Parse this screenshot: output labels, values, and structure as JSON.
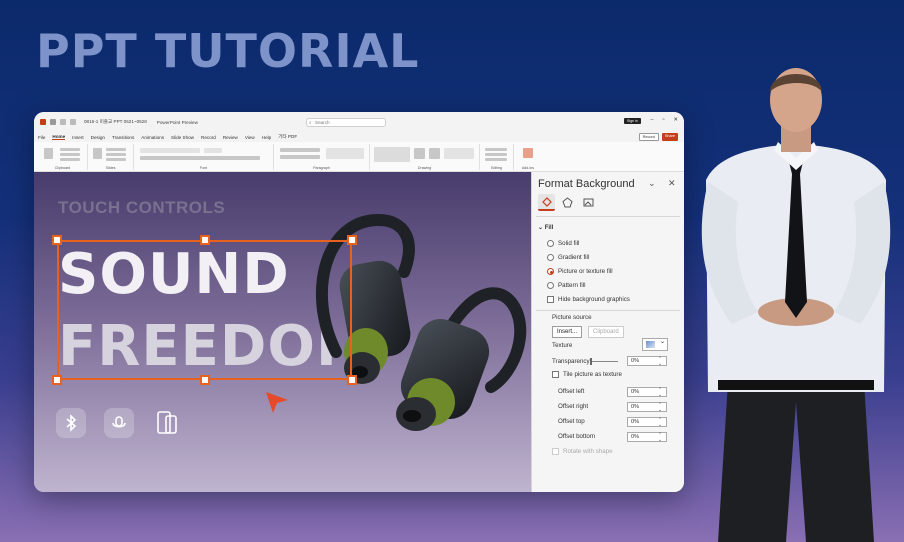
{
  "headline": "PPT TUTORIAL",
  "app": {
    "title": "0816-1 미출교 PPT 0521~0528",
    "appname": "PowerPoint Preview",
    "search_placeholder": "Search",
    "signin": "Sign in",
    "menu": [
      "File",
      "Home",
      "Insert",
      "Design",
      "Transitions",
      "Animations",
      "Slide Show",
      "Record",
      "Review",
      "View",
      "Help",
      "기타 PDF"
    ],
    "active_menu": "Home",
    "record_label": "Record",
    "share_label": "Share",
    "ribbon_groups": [
      "Clipboard",
      "Slides",
      "Font",
      "Paragraph",
      "Drawing",
      "Editing",
      "Add-ins"
    ]
  },
  "slide": {
    "subtitle": "TOUCH CONTROLS",
    "line1": "SOUND",
    "line2": "FREEDOI",
    "icons": [
      "bluetooth-icon",
      "voice-icon",
      "phone-icon"
    ]
  },
  "panel": {
    "title": "Format Background",
    "fill_heading": "Fill",
    "options": [
      "Solid fill",
      "Gradient fill",
      "Picture or texture fill",
      "Pattern fill"
    ],
    "selected_option": "Picture or texture fill",
    "hide_bg": "Hide background graphics",
    "picture_source": "Picture source",
    "insert": "Insert...",
    "clipboard": "Clipboard",
    "texture": "Texture",
    "transparency": "Transparency",
    "transparency_value": "0%",
    "tile": "Tile picture as texture",
    "offsets": [
      {
        "label": "Offset left",
        "value": "0%"
      },
      {
        "label": "Offset right",
        "value": "0%"
      },
      {
        "label": "Offset top",
        "value": "0%"
      },
      {
        "label": "Offset bottom",
        "value": "0%"
      }
    ],
    "rotate": "Rotate with shape"
  },
  "colors": {
    "accent": "#c43e1c",
    "selection": "#e8611e",
    "headline": "#7d93c9"
  }
}
